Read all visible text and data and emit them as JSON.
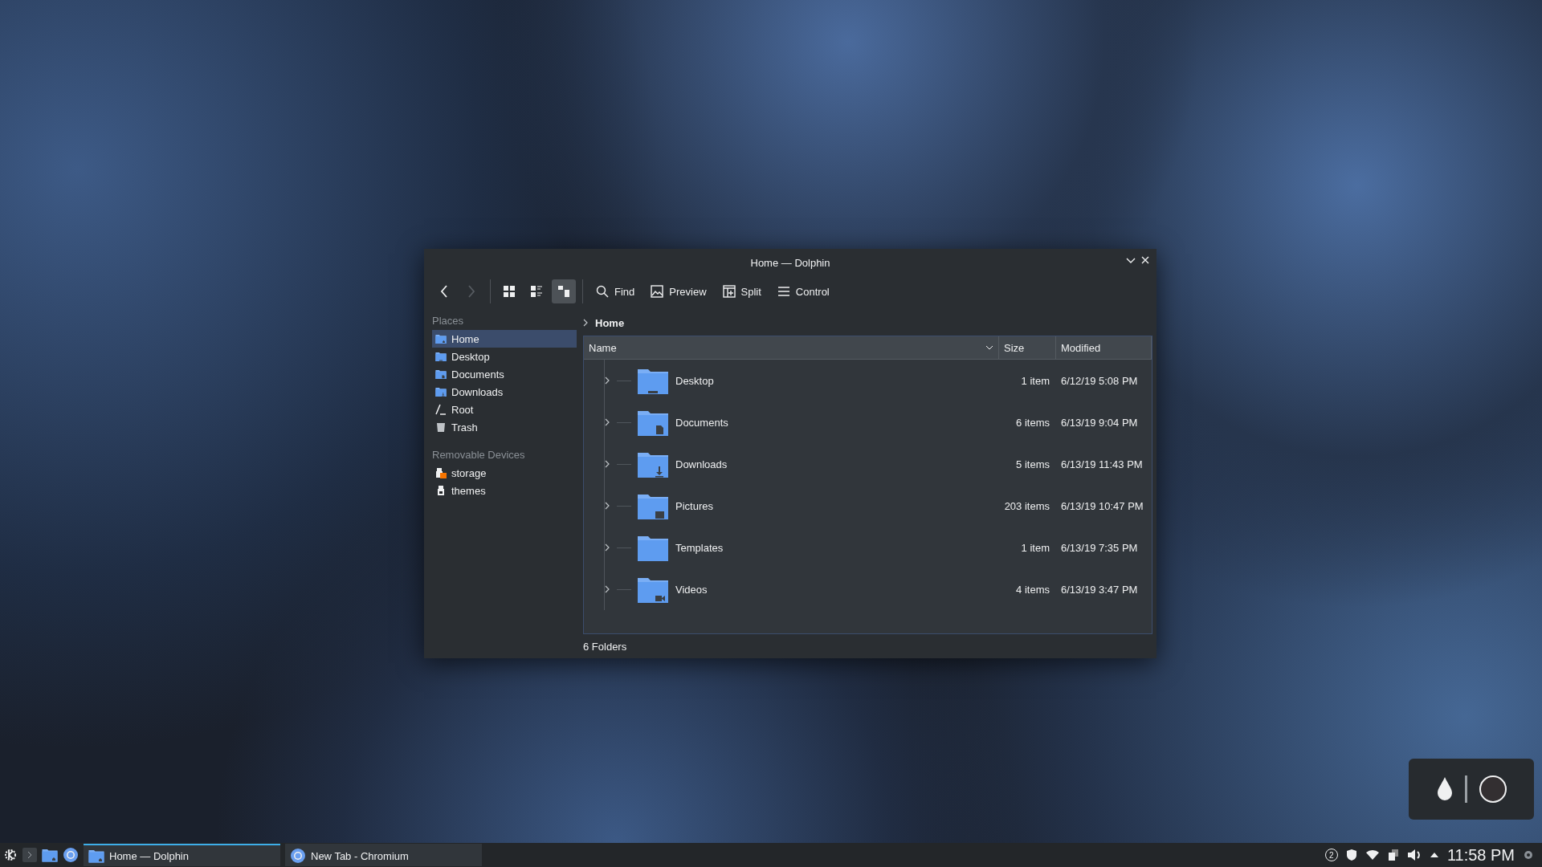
{
  "window": {
    "title": "Home — Dolphin"
  },
  "toolbar": {
    "navigation": [
      {
        "kind": "back",
        "disabled": false
      },
      {
        "kind": "forward",
        "disabled": true
      }
    ],
    "view_modes": [
      {
        "kind": "icons",
        "selected": false
      },
      {
        "kind": "compact",
        "selected": false
      },
      {
        "kind": "details",
        "selected": true
      }
    ],
    "actions": [
      {
        "kind": "find",
        "label": "Find"
      },
      {
        "kind": "preview",
        "label": "Preview"
      },
      {
        "kind": "split",
        "label": "Split"
      },
      {
        "kind": "menu",
        "label": "Control"
      }
    ]
  },
  "sidebar": {
    "sections": [
      {
        "title": "Places",
        "items": [
          {
            "label": "Home",
            "kind": "home",
            "selected": true
          },
          {
            "label": "Desktop",
            "kind": "desktop",
            "selected": false
          },
          {
            "label": "Documents",
            "kind": "documents",
            "selected": false
          },
          {
            "label": "Downloads",
            "kind": "downloads",
            "selected": false
          },
          {
            "label": "Root",
            "kind": "root",
            "selected": false
          },
          {
            "label": "Trash",
            "kind": "trash",
            "selected": false
          }
        ]
      },
      {
        "title": "Removable Devices",
        "items": [
          {
            "label": "storage",
            "kind": "mounted",
            "selected": false
          },
          {
            "label": "themes",
            "kind": "drive",
            "selected": false
          }
        ]
      }
    ]
  },
  "breadcrumb": "Home",
  "table": {
    "columns": [
      "Name",
      "Size",
      "Modified"
    ],
    "rows": [
      {
        "name": "Desktop",
        "kind": "desktop",
        "size": "1 item",
        "modified": "6/12/19 5:08 PM"
      },
      {
        "name": "Documents",
        "kind": "documents",
        "size": "6 items",
        "modified": "6/13/19 9:04 PM"
      },
      {
        "name": "Downloads",
        "kind": "downloads",
        "size": "5 items",
        "modified": "6/13/19 11:43 PM"
      },
      {
        "name": "Pictures",
        "kind": "pictures",
        "size": "203 items",
        "modified": "6/13/19 10:47 PM"
      },
      {
        "name": "Templates",
        "kind": "templates",
        "size": "1 item",
        "modified": "6/13/19 7:35 PM"
      },
      {
        "name": "Videos",
        "kind": "videos",
        "size": "4 items",
        "modified": "6/13/19 3:47 PM"
      }
    ]
  },
  "status_bar": "6 Folders",
  "taskbar": {
    "launchers": [
      {
        "kind": "kde"
      },
      {
        "kind": "terminal"
      },
      {
        "kind": "files"
      },
      {
        "kind": "browser"
      }
    ],
    "tasks": [
      {
        "label": "Home — Dolphin",
        "kind": "files",
        "selected": true
      },
      {
        "label": "New Tab - Chromium",
        "kind": "browser",
        "selected": false
      }
    ],
    "tray": {
      "notifications": "2",
      "clock": "11:58 PM"
    }
  }
}
